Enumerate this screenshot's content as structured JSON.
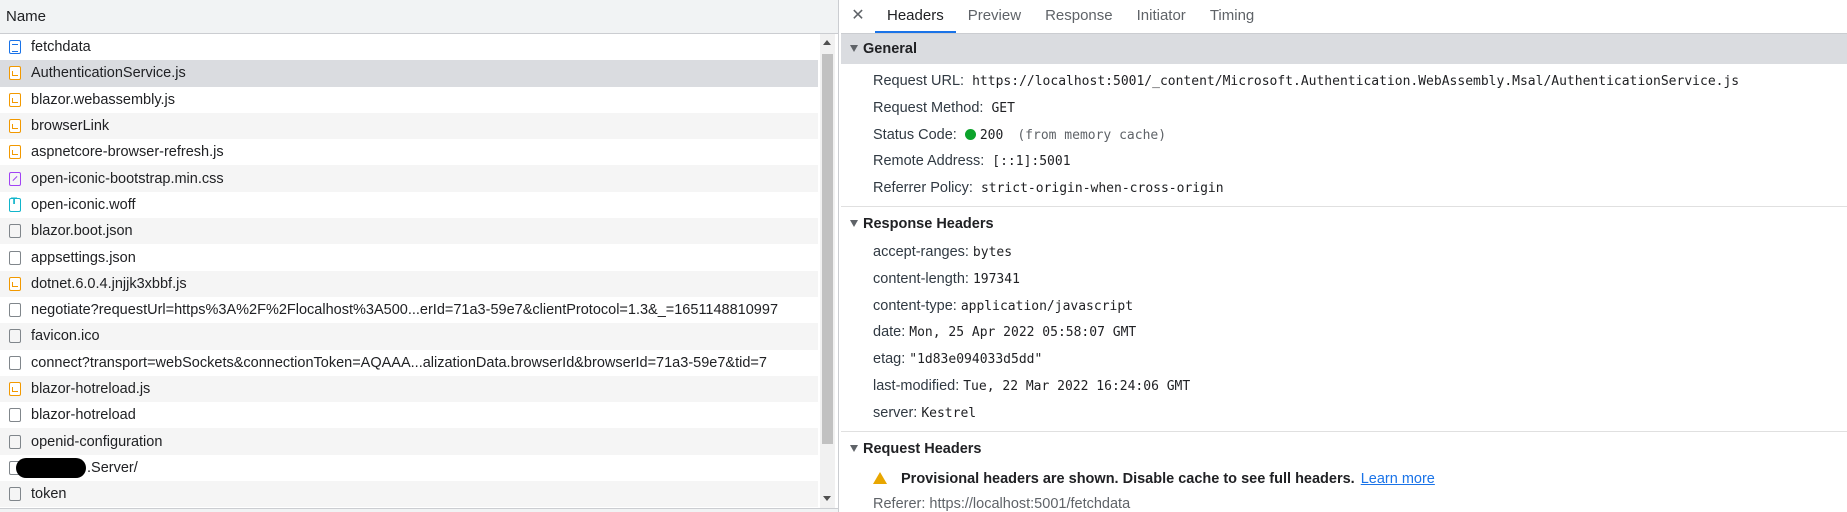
{
  "request_list": {
    "column_header": "Name",
    "rows": [
      {
        "name": "fetchdata",
        "type": "doc"
      },
      {
        "name": "AuthenticationService.js",
        "type": "js"
      },
      {
        "name": "blazor.webassembly.js",
        "type": "js"
      },
      {
        "name": "browserLink",
        "type": "js"
      },
      {
        "name": "aspnetcore-browser-refresh.js",
        "type": "js"
      },
      {
        "name": "open-iconic-bootstrap.min.css",
        "type": "css"
      },
      {
        "name": "open-iconic.woff",
        "type": "font"
      },
      {
        "name": "blazor.boot.json",
        "type": "blank"
      },
      {
        "name": "appsettings.json",
        "type": "blank"
      },
      {
        "name": "dotnet.6.0.4.jnjjk3xbbf.js",
        "type": "js"
      },
      {
        "name": "negotiate?requestUrl=https%3A%2F%2Flocalhost%3A500...erId=71a3-59e7&clientProtocol=1.3&_=1651148810997",
        "type": "blank"
      },
      {
        "name": "favicon.ico",
        "type": "blank"
      },
      {
        "name": "connect?transport=webSockets&connectionToken=AQAAA...alizationData.browserId&browserId=71a3-59e7&tid=7",
        "type": "blank"
      },
      {
        "name": "blazor-hotreload.js",
        "type": "js"
      },
      {
        "name": "blazor-hotreload",
        "type": "blank"
      },
      {
        "name": "openid-configuration",
        "type": "blank"
      },
      {
        "name": ".Server/",
        "type": "blank"
      },
      {
        "name": "token",
        "type": "blank"
      }
    ]
  },
  "details": {
    "close_symbol": "✕",
    "tabs": [
      "Headers",
      "Preview",
      "Response",
      "Initiator",
      "Timing"
    ],
    "general": {
      "title": "General",
      "request_url_label": "Request URL:",
      "request_url": "https://localhost:5001/_content/Microsoft.Authentication.WebAssembly.Msal/AuthenticationService.js",
      "request_method_label": "Request Method:",
      "request_method": "GET",
      "status_code_label": "Status Code:",
      "status_code": "200",
      "status_note": "(from memory cache)",
      "remote_address_label": "Remote Address:",
      "remote_address": "[::1]:5001",
      "referrer_policy_label": "Referrer Policy:",
      "referrer_policy": "strict-origin-when-cross-origin"
    },
    "response_headers": {
      "title": "Response Headers",
      "items": [
        {
          "k": "accept-ranges:",
          "v": "bytes"
        },
        {
          "k": "content-length:",
          "v": "197341"
        },
        {
          "k": "content-type:",
          "v": "application/javascript"
        },
        {
          "k": "date:",
          "v": "Mon, 25 Apr 2022 05:58:07 GMT"
        },
        {
          "k": "etag:",
          "v": "\"1d83e094033d5dd\""
        },
        {
          "k": "last-modified:",
          "v": "Tue, 22 Mar 2022 16:24:06 GMT"
        },
        {
          "k": "server:",
          "v": "Kestrel"
        }
      ]
    },
    "request_headers": {
      "title": "Request Headers",
      "warning": "Provisional headers are shown. Disable cache to see full headers.",
      "learn_more": "Learn more",
      "cut_line": "Referer: https://localhost:5001/fetchdata"
    }
  },
  "colors": {
    "selected_row": "#dadce0",
    "accent": "#1a73e8",
    "status_ok": "#0ca32b",
    "warning": "#e8a600"
  }
}
